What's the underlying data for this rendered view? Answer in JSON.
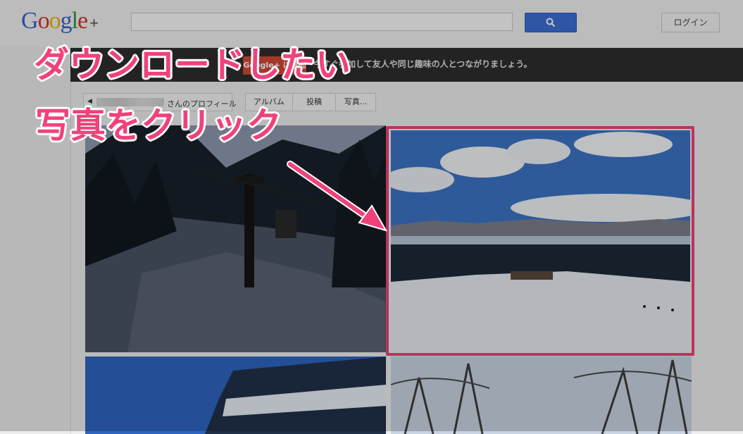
{
  "header": {
    "logo_text": "Google",
    "logo_plus": "+",
    "search": {
      "value": "",
      "placeholder": ""
    },
    "search_button_icon": "search-icon",
    "login_label": "ログイン"
  },
  "promo": {
    "button_label": "Google+ に参加",
    "text": "今すぐ参加して友人や同じ趣味の人とつながりましょう。"
  },
  "toolbar": {
    "back_label": "さんのプロフィール",
    "tabs": [
      "アルバム",
      "投稿",
      "写真..."
    ]
  },
  "photos": [
    {
      "name": "ski-lift-photo"
    },
    {
      "name": "ski-slope-lake-photo"
    },
    {
      "name": "lodge-roof-photo"
    },
    {
      "name": "snowy-trees-photo"
    }
  ],
  "annotations": {
    "line1": "ダウンロードしたい",
    "line2": "写真をクリック",
    "color": "#f0427a"
  }
}
